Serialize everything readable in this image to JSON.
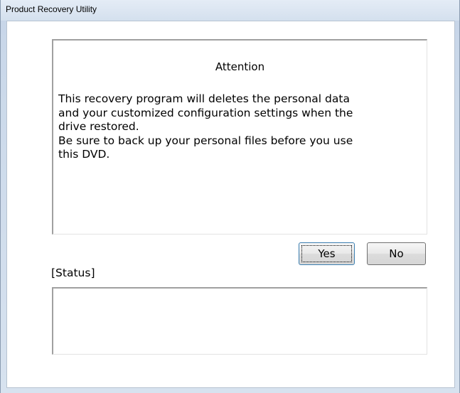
{
  "window": {
    "title": "Product Recovery Utility"
  },
  "attention": {
    "heading": "Attention",
    "lines": [
      "This recovery program will deletes the personal data",
      "and your customized configuration settings when the",
      "drive restored.",
      "Be sure to back up your personal files before you use",
      "this DVD."
    ]
  },
  "buttons": {
    "yes_label": "Yes",
    "no_label": "No"
  },
  "status": {
    "label": "[Status]",
    "text": ""
  },
  "colors": {
    "frame": "#c7d5e8",
    "client_background": "#ffffff",
    "focus_border": "#3c7fb1"
  }
}
